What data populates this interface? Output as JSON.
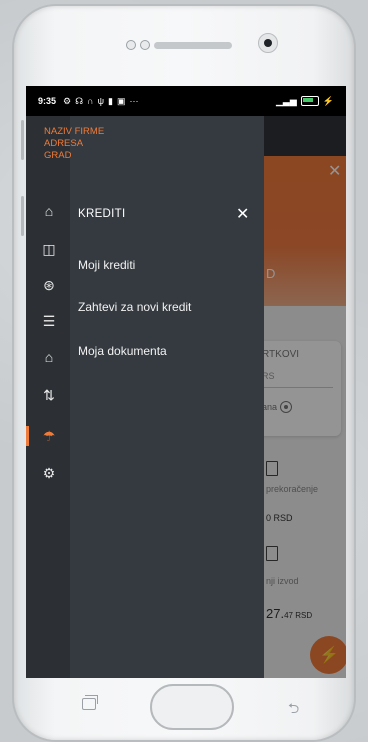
{
  "status_bar": {
    "time": "9:35",
    "left_icons": [
      "gear-icon",
      "headphones-icon",
      "headset-icon",
      "usb-icon",
      "nfc-icon",
      "image-icon"
    ],
    "more": "···",
    "right_icons": [
      "signal-icon",
      "battery-icon",
      "charging-icon"
    ]
  },
  "company": {
    "name": "NAZIV FIRME",
    "address": "ADRESA",
    "city": "GRAD"
  },
  "rail": {
    "items": [
      {
        "icon": "home-icon",
        "glyph": "⌂"
      },
      {
        "icon": "wallet-icon",
        "glyph": "◫"
      },
      {
        "icon": "coins-icon",
        "glyph": "⊛"
      },
      {
        "icon": "card-stack-icon",
        "glyph": "☰"
      },
      {
        "icon": "bank-icon",
        "glyph": "⌂"
      },
      {
        "icon": "transfer-icon",
        "glyph": "⇅"
      },
      {
        "icon": "loan-icon",
        "glyph": "☂",
        "active": true
      },
      {
        "icon": "settings-icon",
        "glyph": "⚙"
      }
    ]
  },
  "panel": {
    "title": "KREDITI",
    "close_glyph": "✕",
    "items": [
      {
        "label": "Moji krediti"
      },
      {
        "label": "Zahtevi za novi kredit"
      },
      {
        "label": "Moja dokumenta"
      }
    ]
  },
  "background": {
    "orange_text": "D",
    "card_title": "RTKOVI",
    "card_value": "RS",
    "card_footer": "ana",
    "row1": "prekoračenje",
    "row1_value": "0 RSD",
    "row2": "nji izvod",
    "row2_value": "27.",
    "row2_cents": "47 RSD",
    "close_glyph": "✕",
    "fab_glyph": "⚡"
  },
  "colors": {
    "accent": "#ef7b3a",
    "drawer": "#343a40",
    "rail": "#2c3034"
  }
}
